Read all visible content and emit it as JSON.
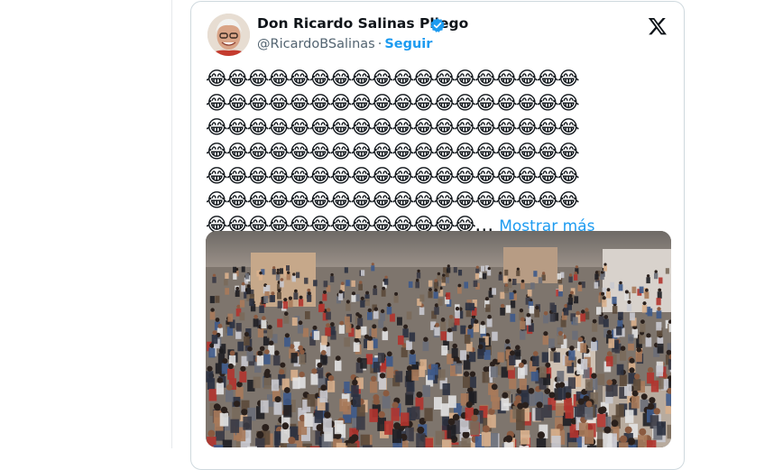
{
  "tweet": {
    "author_name": "Don Ricardo Salinas Pliego",
    "handle": "@RicardoBSalinas",
    "separator": "·",
    "follow_label": "Seguir",
    "emoji": "😂",
    "emoji_rows": [
      18,
      18,
      18,
      18,
      18,
      18,
      13
    ],
    "show_more_label": "Mostrar más"
  },
  "icons": {
    "verified": "verified-badge-icon",
    "platform": "x-logo-icon"
  },
  "colors": {
    "link": "#1d9bf0",
    "text": "#0f1419",
    "muted": "#536471",
    "border": "#cfd9de"
  }
}
